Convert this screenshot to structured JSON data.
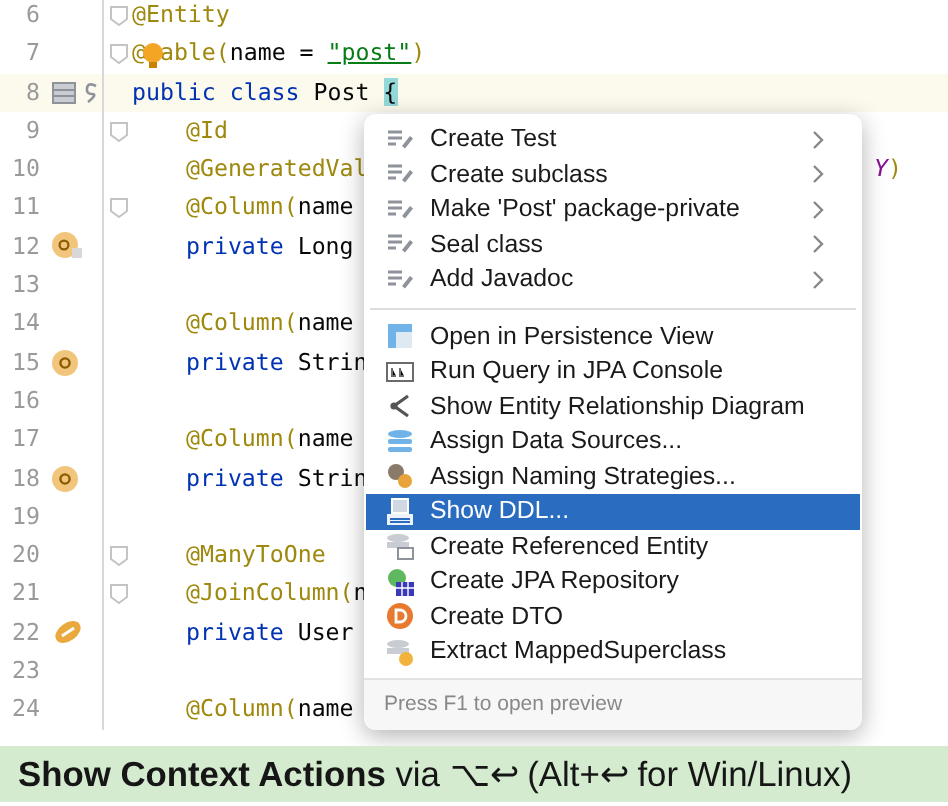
{
  "editor": {
    "lines": [
      {
        "number": "6",
        "segments": [
          {
            "kind": "annotation",
            "text": "@Entity"
          }
        ],
        "fold": true
      },
      {
        "number": "7",
        "segments": [
          {
            "kind": "annotation",
            "text": "@"
          },
          {
            "kind": "bulb"
          },
          {
            "kind": "annotation",
            "text": "able("
          },
          {
            "kind": "plain",
            "text": "name = "
          },
          {
            "kind": "string",
            "text": "\"post\""
          },
          {
            "kind": "annotation",
            "text": ")"
          }
        ],
        "fold": true
      },
      {
        "number": "8",
        "segments": [
          {
            "kind": "keyword",
            "text": "public class "
          },
          {
            "kind": "plain",
            "text": "Post "
          },
          {
            "kind": "brace",
            "text": "{"
          }
        ],
        "current": true,
        "gutter": {
          "kind": "table"
        }
      },
      {
        "number": "9",
        "indent": true,
        "segments": [
          {
            "kind": "annotation",
            "text": "@Id"
          }
        ],
        "fold": true
      },
      {
        "number": "10",
        "indent": true,
        "segments": [
          {
            "kind": "annotation",
            "text": "@GeneratedVal"
          }
        ],
        "tail": [
          {
            "kind": "constant",
            "text": "Y"
          },
          {
            "kind": "annotation",
            "text": ")"
          }
        ]
      },
      {
        "number": "11",
        "indent": true,
        "segments": [
          {
            "kind": "annotation",
            "text": "@Column("
          },
          {
            "kind": "plain",
            "text": "name"
          }
        ],
        "fold": true
      },
      {
        "number": "12",
        "indent": true,
        "segments": [
          {
            "kind": "keyword",
            "text": "private "
          },
          {
            "kind": "plain",
            "text": "Long"
          }
        ],
        "gutter": {
          "kind": "id-badge"
        }
      },
      {
        "number": "13"
      },
      {
        "number": "14",
        "indent": true,
        "segments": [
          {
            "kind": "annotation",
            "text": "@Column("
          },
          {
            "kind": "plain",
            "text": "name"
          }
        ]
      },
      {
        "number": "15",
        "indent": true,
        "segments": [
          {
            "kind": "keyword",
            "text": "private "
          },
          {
            "kind": "plain",
            "text": "Strin"
          }
        ],
        "gutter": {
          "kind": "badge"
        }
      },
      {
        "number": "16"
      },
      {
        "number": "17",
        "indent": true,
        "segments": [
          {
            "kind": "annotation",
            "text": "@Column("
          },
          {
            "kind": "plain",
            "text": "name"
          }
        ]
      },
      {
        "number": "18",
        "indent": true,
        "segments": [
          {
            "kind": "keyword",
            "text": "private "
          },
          {
            "kind": "plain",
            "text": "Strin"
          }
        ],
        "gutter": {
          "kind": "badge"
        }
      },
      {
        "number": "19"
      },
      {
        "number": "20",
        "indent": true,
        "segments": [
          {
            "kind": "annotation",
            "text": "@ManyToOne"
          }
        ],
        "fold": true
      },
      {
        "number": "21",
        "indent": true,
        "segments": [
          {
            "kind": "annotation",
            "text": "@JoinColumn("
          },
          {
            "kind": "plain",
            "text": "n"
          }
        ],
        "fold": true
      },
      {
        "number": "22",
        "indent": true,
        "segments": [
          {
            "kind": "keyword",
            "text": "private "
          },
          {
            "kind": "plain",
            "text": "User"
          }
        ],
        "gutter": {
          "kind": "relation"
        }
      },
      {
        "number": "23"
      },
      {
        "number": "24",
        "indent": true,
        "segments": [
          {
            "kind": "annotation",
            "text": "@Column("
          },
          {
            "kind": "plain",
            "text": "name"
          }
        ]
      }
    ]
  },
  "menu": {
    "groups": [
      [
        {
          "kind": "intention",
          "label": "Create Test",
          "submenu": true,
          "selected": false
        },
        {
          "kind": "intention",
          "label": "Create subclass",
          "submenu": true,
          "selected": false
        },
        {
          "kind": "intention",
          "label": "Make 'Post' package-private",
          "submenu": true,
          "selected": false
        },
        {
          "kind": "intention",
          "label": "Seal class",
          "submenu": true,
          "selected": false
        },
        {
          "kind": "intention",
          "label": "Add Javadoc",
          "submenu": true,
          "selected": false
        }
      ],
      [
        {
          "kind": "persistence",
          "label": "Open in Persistence View",
          "selected": false
        },
        {
          "kind": "query",
          "label": "Run Query in JPA Console",
          "selected": false
        },
        {
          "kind": "diagram",
          "label": "Show Entity Relationship Diagram",
          "selected": false
        },
        {
          "kind": "datasource",
          "label": "Assign Data Sources...",
          "selected": false
        },
        {
          "kind": "naming",
          "label": "Assign Naming Strategies...",
          "selected": false
        },
        {
          "kind": "ddl",
          "label": "Show DDL...",
          "selected": true
        },
        {
          "kind": "entity",
          "label": "Create Referenced Entity",
          "selected": false
        },
        {
          "kind": "repository",
          "label": "Create JPA Repository",
          "selected": false
        },
        {
          "kind": "dto",
          "label": "Create DTO",
          "selected": false
        },
        {
          "kind": "superclass",
          "label": "Extract MappedSuperclass",
          "selected": false
        }
      ]
    ],
    "footer": "Press F1 to open preview"
  },
  "banner": "**Show Context Actions** via ⌥↩ (Alt+↩ for Win/Linux)"
}
